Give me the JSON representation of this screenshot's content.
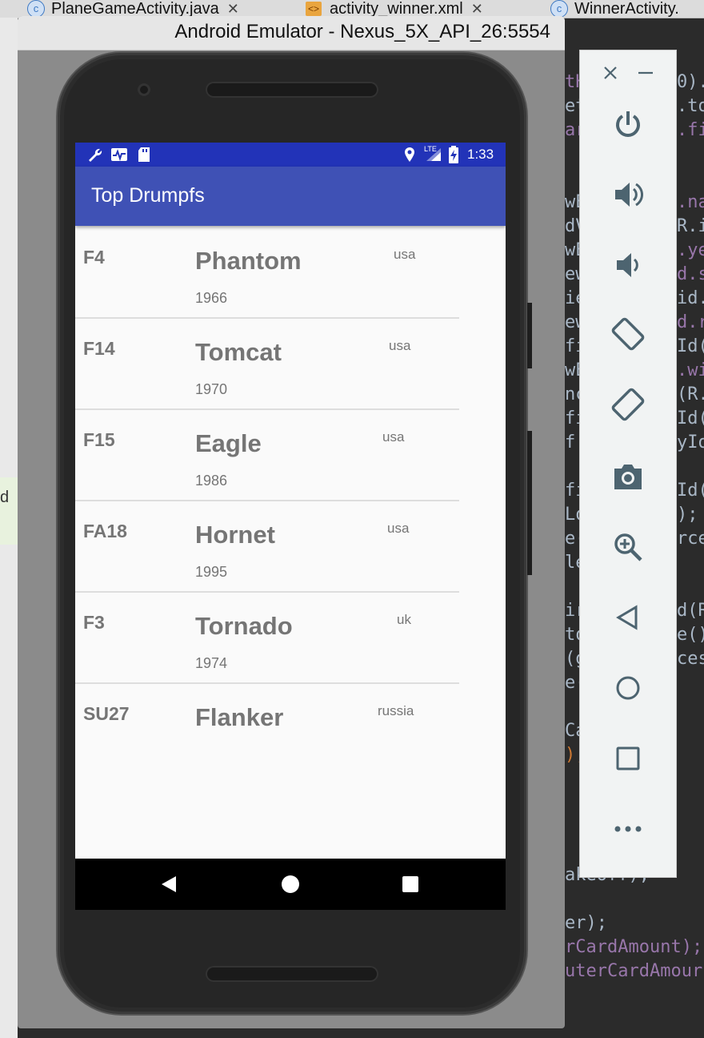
{
  "ide": {
    "tabs": [
      {
        "label": "PlaneGameActivity.java",
        "icon": "c"
      },
      {
        "label": "activity_winner.xml",
        "icon": "<>"
      },
      {
        "label": "WinnerActivity.",
        "icon": "c"
      }
    ],
    "left_gutter_char": "d",
    "code_lines": [
      {
        "text": "tH",
        "color": "#9876aa"
      },
      {
        "text": "et",
        "color": "#a9b7c6"
      },
      {
        "text": "ar",
        "color": "#9876aa"
      },
      {
        "text": "wE",
        "color": "#a9b7c6"
      },
      {
        "text": "dV",
        "color": "#a9b7c6"
      },
      {
        "text": "wE",
        "color": "#a9b7c6"
      },
      {
        "text": "ew",
        "color": "#a9b7c6"
      },
      {
        "text": "ie",
        "color": "#a9b7c6"
      },
      {
        "text": "ew",
        "color": "#a9b7c6"
      },
      {
        "text": "fi",
        "color": "#a9b7c6"
      },
      {
        "text": "wE",
        "color": "#a9b7c6"
      },
      {
        "text": "nc",
        "color": "#a9b7c6"
      },
      {
        "text": "fi",
        "color": "#a9b7c6"
      },
      {
        "text": " f",
        "color": "#a9b7c6"
      },
      {
        "text": "fi",
        "color": "#a9b7c6"
      },
      {
        "text": "Lo",
        "color": "#a9b7c6"
      },
      {
        "text": "e(",
        "color": "#a9b7c6"
      },
      {
        "text": "le",
        "color": "#a9b7c6"
      },
      {
        "text": "ir",
        "color": "#a9b7c6"
      },
      {
        "text": "to",
        "color": "#a9b7c6"
      },
      {
        "text": "(g",
        "color": "#a9b7c6"
      },
      {
        "text": "e(",
        "color": "#a9b7c6"
      },
      {
        "text": "Ca",
        "color": "#a9b7c6"
      },
      {
        "text": ");",
        "color": "#cc7832"
      },
      {
        "text": "akeoff);",
        "color": "#a9b7c6"
      },
      {
        "text": "er);",
        "color": "#a9b7c6"
      },
      {
        "text": "rCardAmount);",
        "color": "#9876aa"
      },
      {
        "text": "uterCardAmour",
        "color": "#9876aa"
      }
    ],
    "code_right": [
      "0).",
      ".to",
      ".fi",
      ".na",
      "R.i",
      ".ye",
      "d.s",
      "id.",
      "d.r",
      "Id(",
      ".wi",
      "(R.",
      "Id(",
      "yIo",
      "Id(",
      ");",
      "rce",
      "d(R",
      "e()",
      "ces"
    ]
  },
  "emulator": {
    "title": "Android Emulator - Nexus_5X_API_26:5554"
  },
  "status_bar": {
    "time": "1:33",
    "network": "LTE"
  },
  "app": {
    "title": "Top Drumpfs",
    "planes": [
      {
        "id": "F4",
        "name": "Phantom",
        "year": "1966",
        "country": "usa"
      },
      {
        "id": "F14",
        "name": "Tomcat",
        "year": "1970",
        "country": "usa"
      },
      {
        "id": "F15",
        "name": "Eagle",
        "year": "1986",
        "country": "usa"
      },
      {
        "id": "FA18",
        "name": "Hornet",
        "year": "1995",
        "country": "usa"
      },
      {
        "id": "F3",
        "name": "Tornado",
        "year": "1974",
        "country": "uk"
      },
      {
        "id": "SU27",
        "name": "Flanker",
        "year": "",
        "country": "russia"
      }
    ]
  },
  "side_panel": {
    "icons": [
      "close-icon",
      "minimize-icon",
      "power-icon",
      "volume-up-icon",
      "volume-down-icon",
      "rotate-left-icon",
      "rotate-right-icon",
      "camera-icon",
      "zoom-icon",
      "back-icon",
      "home-icon",
      "overview-icon",
      "more-icon"
    ]
  }
}
